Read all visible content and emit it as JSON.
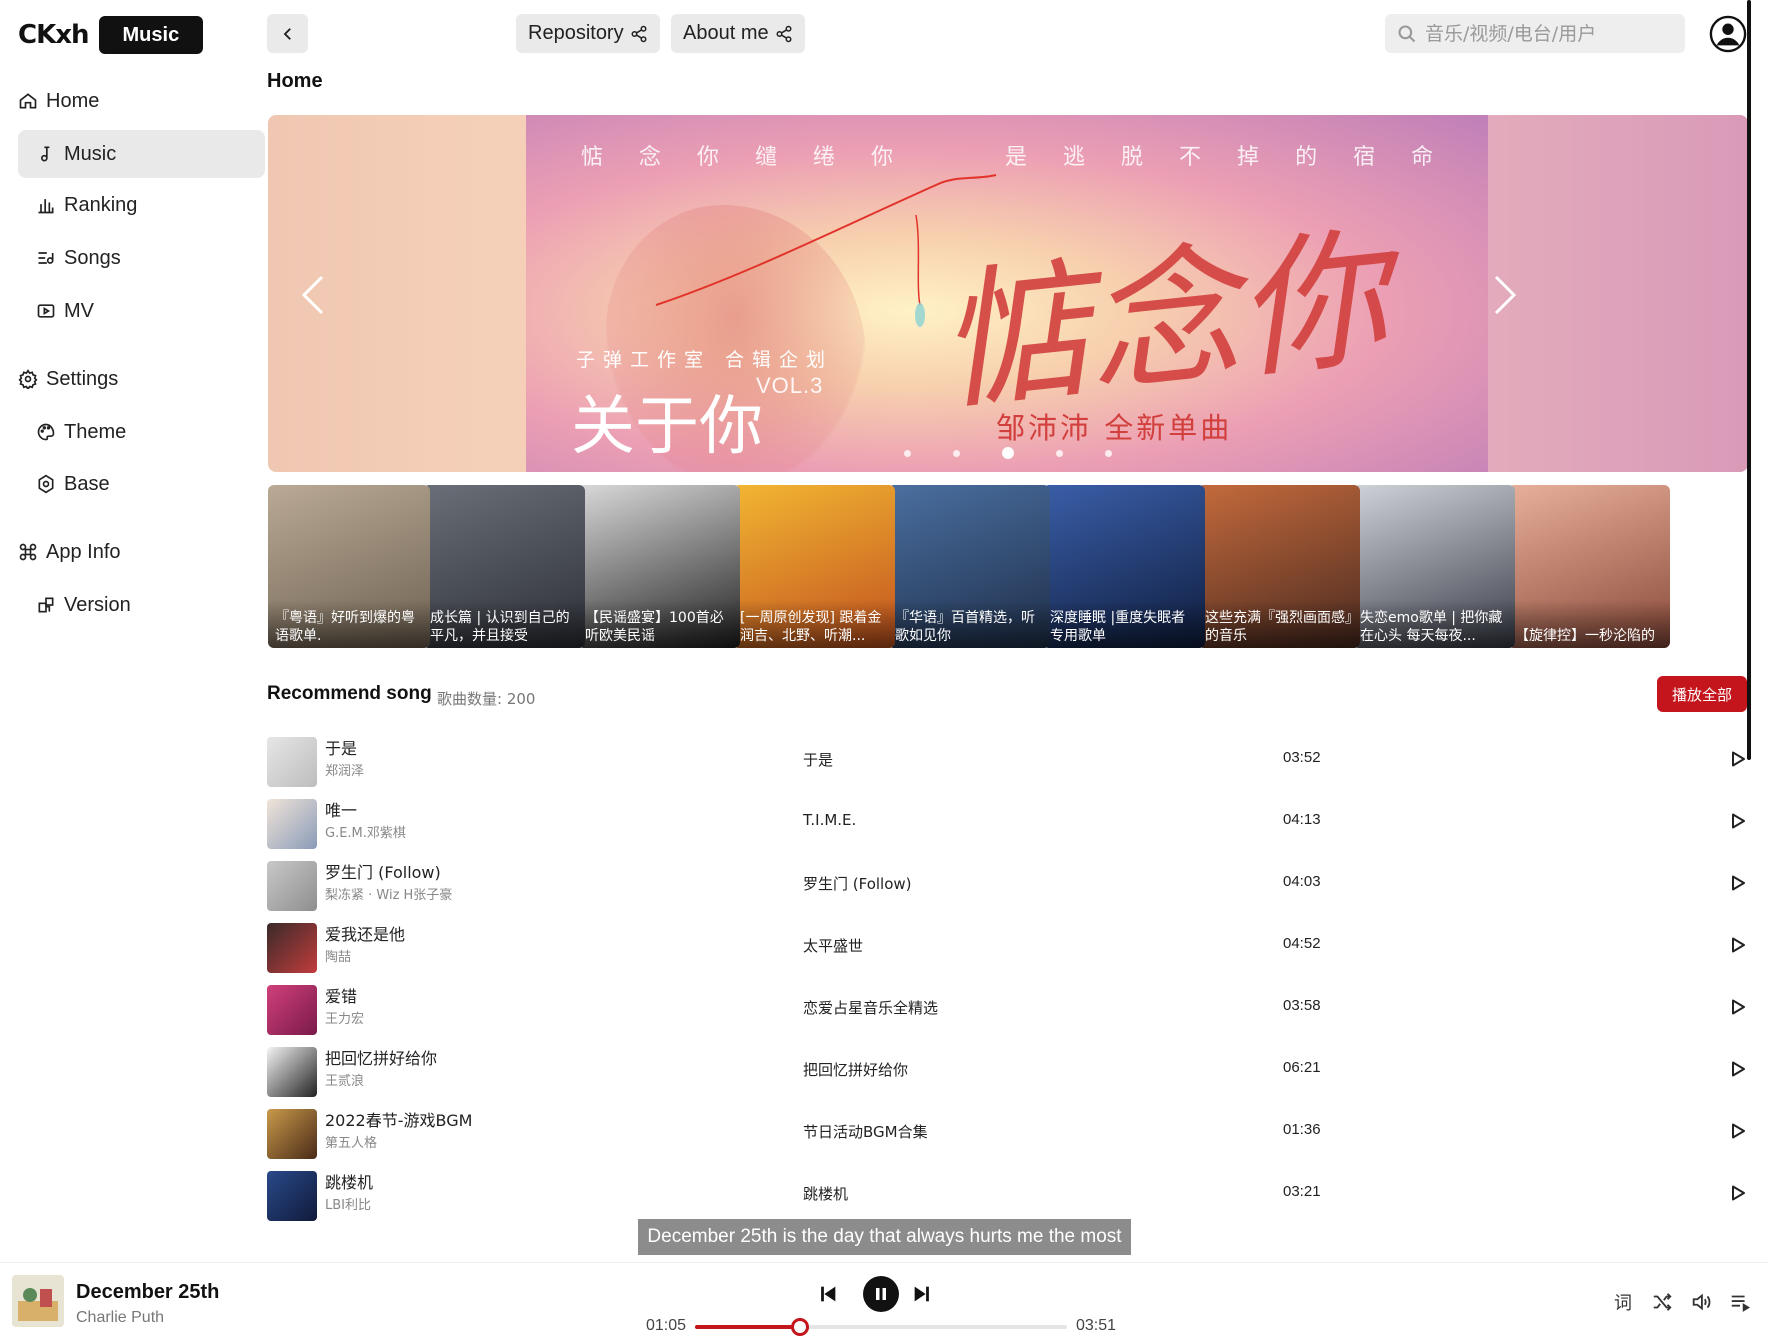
{
  "brand": {
    "logo_text": "CKxh",
    "badge": "Music"
  },
  "sidebar": {
    "home": "Home",
    "music": "Music",
    "ranking": "Ranking",
    "songs": "Songs",
    "mv": "MV",
    "settings": "Settings",
    "theme": "Theme",
    "base": "Base",
    "app_info": "App Info",
    "version": "Version"
  },
  "topbar": {
    "repository": "Repository",
    "about_me": "About me",
    "search_placeholder": "音乐/视频/电台/用户"
  },
  "page_title": "Home",
  "banner": {
    "top_line_left": [
      "惦",
      "念",
      "你",
      "缱",
      "绻",
      "你"
    ],
    "top_line_right": [
      "是",
      "逃",
      "脱",
      "不",
      "掉",
      "的",
      "宿",
      "命"
    ],
    "studio": "子弹工作室 合辑企划",
    "album": "关于你",
    "vol": "VOL.3",
    "script_title": "惦念你",
    "artist_line": "邹沛沛  全新单曲",
    "dot_count": 5,
    "active_dot": 2
  },
  "playlists": [
    {
      "title": "『粤语』好听到爆的粤语歌单.",
      "color1": "#b9a995",
      "color2": "#6f6252"
    },
    {
      "title": "成长篇 | 认识到自己的平凡，并且接受",
      "color1": "#6a6f78",
      "color2": "#2c2f36"
    },
    {
      "title": "【民谣盛宴】100首必听欧美民谣",
      "color1": "#d9d9d9",
      "color2": "#222222"
    },
    {
      "title": "[一周原创发现] 跟着金润吉、北野、听潮...",
      "color1": "#f2b632",
      "color2": "#c2521f"
    },
    {
      "title": "『华语』百首精选，听歌如见你",
      "color1": "#4a6fa0",
      "color2": "#1f2f4a"
    },
    {
      "title": "深度睡眠 |重度失眠者专用歌单",
      "color1": "#3a5ea8",
      "color2": "#0f1d3e"
    },
    {
      "title": "这些充满『强烈画面感』的音乐",
      "color1": "#c46a3c",
      "color2": "#4a2a20"
    },
    {
      "title": "失恋emo歌单 | 把你藏在心头 每天每夜...",
      "color1": "#cfd2d8",
      "color2": "#3a3d48"
    },
    {
      "title": "【旋律控】一秒沦陷的",
      "color1": "#e8b09a",
      "color2": "#8a4a3a"
    }
  ],
  "recommend": {
    "title": "Recommend song",
    "count_label": "歌曲数量: 200",
    "play_all": "播放全部",
    "songs": [
      {
        "name": "于是",
        "artist": "郑润泽",
        "album": "于是",
        "duration": "03:52",
        "c1": "#e6e6e6",
        "c2": "#bdbdbd"
      },
      {
        "name": "唯一",
        "artist": "G.E.M.邓紫棋",
        "album": "T.I.M.E.",
        "duration": "04:13",
        "c1": "#f0e4d8",
        "c2": "#8a9bb8"
      },
      {
        "name": "罗生门 (Follow)",
        "artist": "梨冻紧 · Wiz H张子豪",
        "album": "罗生门 (Follow)",
        "duration": "04:03",
        "c1": "#c8c8c8",
        "c2": "#8e8e8e"
      },
      {
        "name": "爱我还是他",
        "artist": "陶喆",
        "album": "太平盛世",
        "duration": "04:52",
        "c1": "#3a2a2a",
        "c2": "#c23c3c"
      },
      {
        "name": "爱错",
        "artist": "王力宏",
        "album": "恋爱占星音乐全精选",
        "duration": "03:58",
        "c1": "#d0407a",
        "c2": "#7a1a4a"
      },
      {
        "name": "把回忆拼好给你",
        "artist": "王贰浪",
        "album": "把回忆拼好给你",
        "duration": "06:21",
        "c1": "#f4f4f4",
        "c2": "#222222"
      },
      {
        "name": "2022春节-游戏BGM",
        "artist": "第五人格",
        "album": "节日活动BGM合集",
        "duration": "01:36",
        "c1": "#c89a4a",
        "c2": "#4a2a18"
      },
      {
        "name": "跳楼机",
        "artist": "LBI利比",
        "album": "跳楼机",
        "duration": "03:21",
        "c1": "#2a4a8a",
        "c2": "#101a3a"
      }
    ]
  },
  "lyric": "December 25th is the day that always hurts me the most",
  "player": {
    "title": "December 25th",
    "artist": "Charlie Puth",
    "current_time": "01:05",
    "total_time": "03:51",
    "progress": 0.283,
    "lyric_icon_label": "词"
  },
  "colors": {
    "accent": "#c4141c",
    "sidebar_active": "#e9e9e9"
  }
}
